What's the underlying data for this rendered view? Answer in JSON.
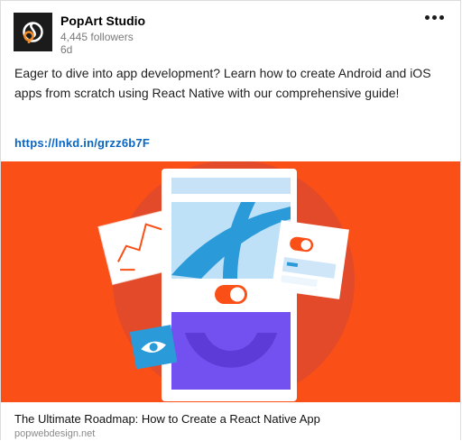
{
  "company": {
    "name": "PopArt Studio",
    "followers": "4,445 followers",
    "time": "6d",
    "logo_icon": "popart-logo-icon"
  },
  "menu": {
    "icon": "more-options-icon"
  },
  "post": {
    "text": "Eager to dive into app development? Learn how to create Android and iOS apps from scratch using React Native with our comprehensive guide!",
    "link": "https://lnkd.in/grzz6b7F"
  },
  "article": {
    "title": "The Ultimate Roadmap: How to Create a React Native App",
    "domain": "popwebdesign.net",
    "image_icon": "app-development-illustration",
    "colors": {
      "background": "#fa4f16",
      "circle": "#e24a2a",
      "phone": "#ffffff",
      "light_blue": "#bfe1f8",
      "blue": "#2a9ad9",
      "purple": "#7350f0"
    }
  },
  "colors": {
    "link": "#0a66c2",
    "secondary_text": "#7a7a7a"
  }
}
